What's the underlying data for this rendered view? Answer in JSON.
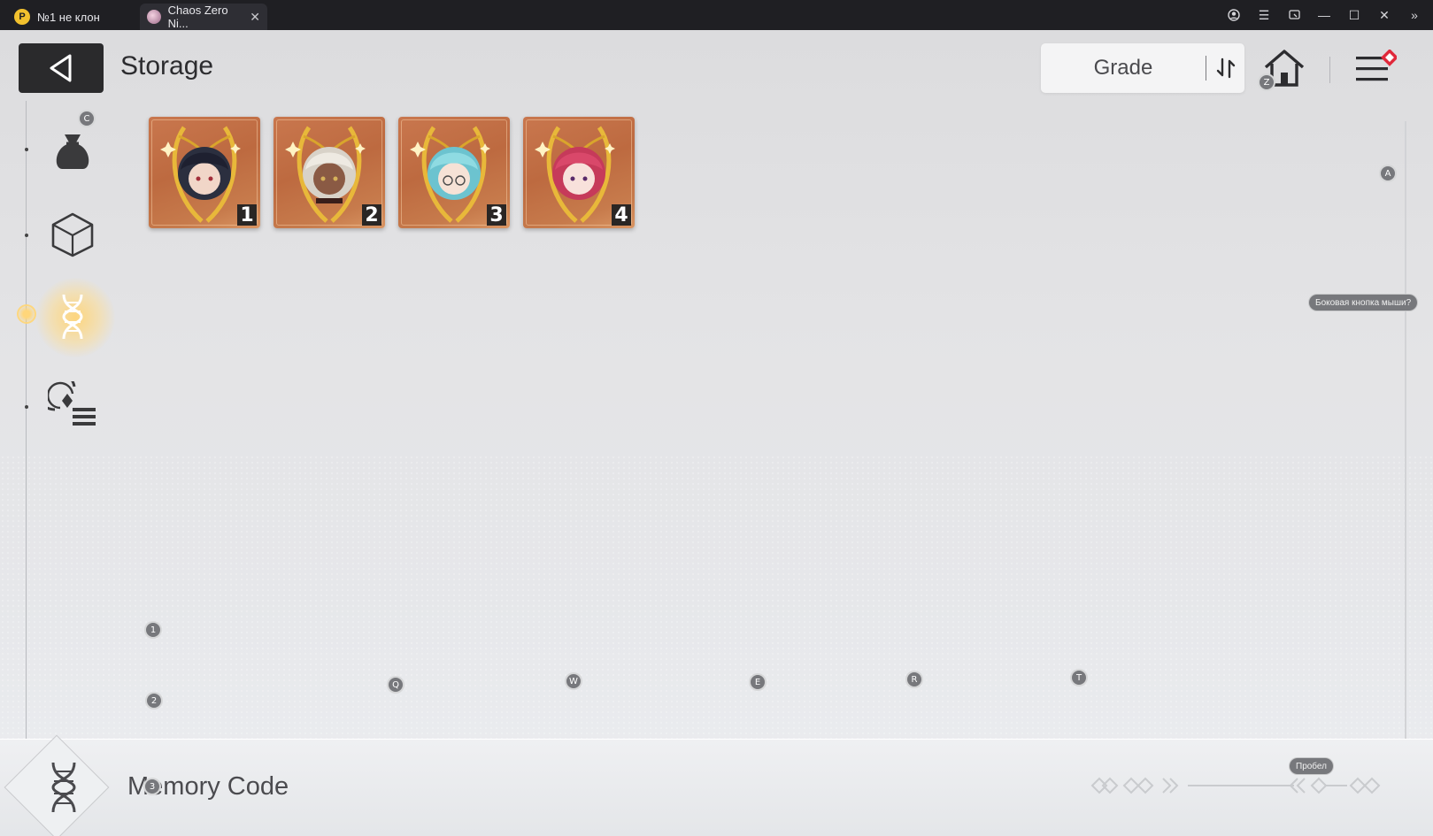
{
  "window": {
    "tabs": [
      {
        "label": "№1 не клон"
      },
      {
        "label": "Chaos Zero Ni..."
      }
    ]
  },
  "header": {
    "title": "Storage",
    "sort": {
      "label": "Grade"
    }
  },
  "sidebar": {
    "items": [
      {
        "icon": "pouch-icon",
        "hotkey": "C"
      },
      {
        "icon": "cube-icon"
      },
      {
        "icon": "dna-icon",
        "active": true
      },
      {
        "icon": "memory-list-icon"
      }
    ]
  },
  "items": [
    {
      "number": "1"
    },
    {
      "number": "2"
    },
    {
      "number": "3"
    },
    {
      "number": "4"
    }
  ],
  "keymap": {
    "z": "Z",
    "c": "C",
    "a": "A",
    "side_mouse": "Боковая кнопка мыши?",
    "num1": "1",
    "num2": "2",
    "num3": "3",
    "q": "Q",
    "w": "W",
    "e": "E",
    "r": "R",
    "t": "T",
    "space": "Пробел"
  },
  "footer": {
    "title": "Memory Code"
  },
  "colors": {
    "card_bg": "#c26f45",
    "accent_red": "#e0283a",
    "active_glow": "#ffd67a"
  }
}
